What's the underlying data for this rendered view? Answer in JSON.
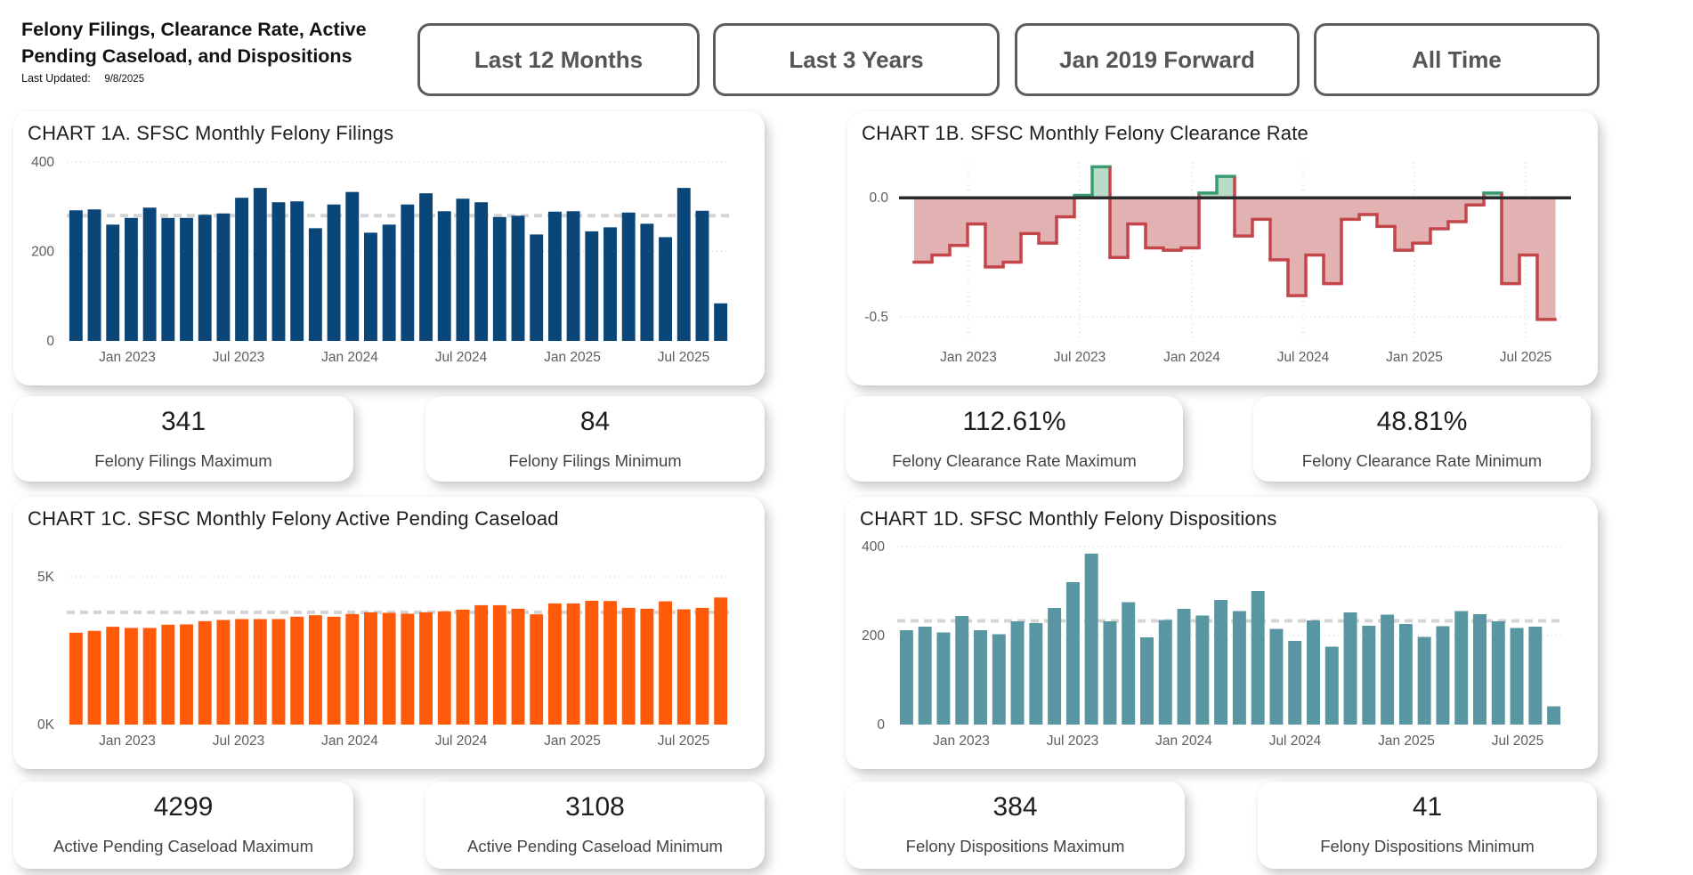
{
  "header": {
    "title": "Felony Filings, Clearance Rate, Active Pending Caseload, and Dispositions",
    "last_updated_label": "Last Updated:",
    "last_updated_value": "9/8/2025"
  },
  "range_buttons": [
    "Last 12 Months",
    "Last 3 Years",
    "Jan 2019 Forward",
    "All Time"
  ],
  "colors": {
    "filings": "#0b4679",
    "caseload": "#ff5a0a",
    "dispositions": "#5896a1",
    "clearance_pos_line": "#3a9b73",
    "clearance_pos_fill": "#b9dcc9",
    "clearance_neg_line": "#c4464a",
    "clearance_neg_fill": "#e2b2b3"
  },
  "chart_data": [
    {
      "id": "1A",
      "type": "bar",
      "title": "CHART 1A. SFSC Monthly Felony Filings",
      "x_ticks": [
        "Jan 2023",
        "Jul 2023",
        "Jan 2024",
        "Jul 2024",
        "Jan 2025",
        "Jul 2025"
      ],
      "y_ticks": [
        "0",
        "200",
        "400"
      ],
      "ylim": [
        0,
        400
      ],
      "average": 280,
      "values": [
        292,
        294,
        260,
        275,
        298,
        275,
        275,
        282,
        285,
        320,
        342,
        310,
        312,
        252,
        305,
        333,
        242,
        260,
        305,
        330,
        290,
        318,
        310,
        277,
        280,
        238,
        289,
        290,
        245,
        254,
        287,
        262,
        232,
        342,
        291,
        84
      ]
    },
    {
      "id": "1B",
      "type": "step-area",
      "title": "CHART 1B. SFSC Monthly Felony Clearance Rate",
      "x_ticks": [
        "Jan 2023",
        "Jul 2023",
        "Jan 2024",
        "Jul 2024",
        "Jan 2025",
        "Jul 2025"
      ],
      "y_ticks": [
        "0.0",
        "-0.5"
      ],
      "ylim": [
        -0.6,
        0.15
      ],
      "values": [
        -0.27,
        -0.24,
        -0.2,
        -0.11,
        -0.29,
        -0.27,
        -0.15,
        -0.19,
        -0.08,
        0.01,
        0.13,
        -0.25,
        -0.11,
        -0.21,
        -0.22,
        -0.21,
        0.02,
        0.09,
        -0.16,
        -0.09,
        -0.26,
        -0.41,
        -0.24,
        -0.36,
        -0.09,
        -0.07,
        -0.12,
        -0.22,
        -0.19,
        -0.13,
        -0.1,
        -0.03,
        0.02,
        -0.36,
        -0.24,
        -0.51
      ]
    },
    {
      "id": "1C",
      "type": "bar",
      "title": "CHART 1C. SFSC Monthly Felony Active Pending Caseload",
      "x_ticks": [
        "Jan 2023",
        "Jul 2023",
        "Jan 2024",
        "Jul 2024",
        "Jan 2025",
        "Jul 2025"
      ],
      "y_ticks": [
        "0K",
        "5K"
      ],
      "ylim": [
        0,
        5000
      ],
      "average": 3800,
      "values": [
        3108,
        3170,
        3310,
        3270,
        3270,
        3380,
        3390,
        3500,
        3540,
        3570,
        3570,
        3570,
        3650,
        3700,
        3650,
        3740,
        3800,
        3780,
        3750,
        3800,
        3830,
        3890,
        4040,
        4040,
        3920,
        3730,
        4100,
        4100,
        4190,
        4180,
        3950,
        3920,
        4170,
        3900,
        3950,
        4299
      ]
    },
    {
      "id": "1D",
      "type": "bar",
      "title": "CHART 1D. SFSC Monthly Felony Dispositions",
      "x_ticks": [
        "Jan 2023",
        "Jul 2023",
        "Jan 2024",
        "Jul 2024",
        "Jan 2025",
        "Jul 2025"
      ],
      "y_ticks": [
        "0",
        "200",
        "400"
      ],
      "ylim": [
        0,
        400
      ],
      "average": 233,
      "values": [
        212,
        220,
        207,
        244,
        212,
        203,
        232,
        228,
        262,
        320,
        384,
        232,
        275,
        196,
        235,
        260,
        245,
        280,
        255,
        300,
        215,
        188,
        234,
        175,
        252,
        222,
        247,
        226,
        197,
        221,
        255,
        248,
        232,
        217,
        220,
        41
      ]
    }
  ],
  "kpis": [
    {
      "value": "341",
      "label": "Felony Filings Maximum"
    },
    {
      "value": "84",
      "label": "Felony Filings Minimum"
    },
    {
      "value": "112.61%",
      "label": "Felony Clearance Rate Maximum"
    },
    {
      "value": "48.81%",
      "label": "Felony Clearance Rate Minimum"
    },
    {
      "value": "4299",
      "label": "Active Pending Caseload Maximum"
    },
    {
      "value": "3108",
      "label": "Active Pending Caseload Minimum"
    },
    {
      "value": "384",
      "label": "Felony Dispositions Maximum"
    },
    {
      "value": "41",
      "label": "Felony Dispositions Minimum"
    }
  ]
}
